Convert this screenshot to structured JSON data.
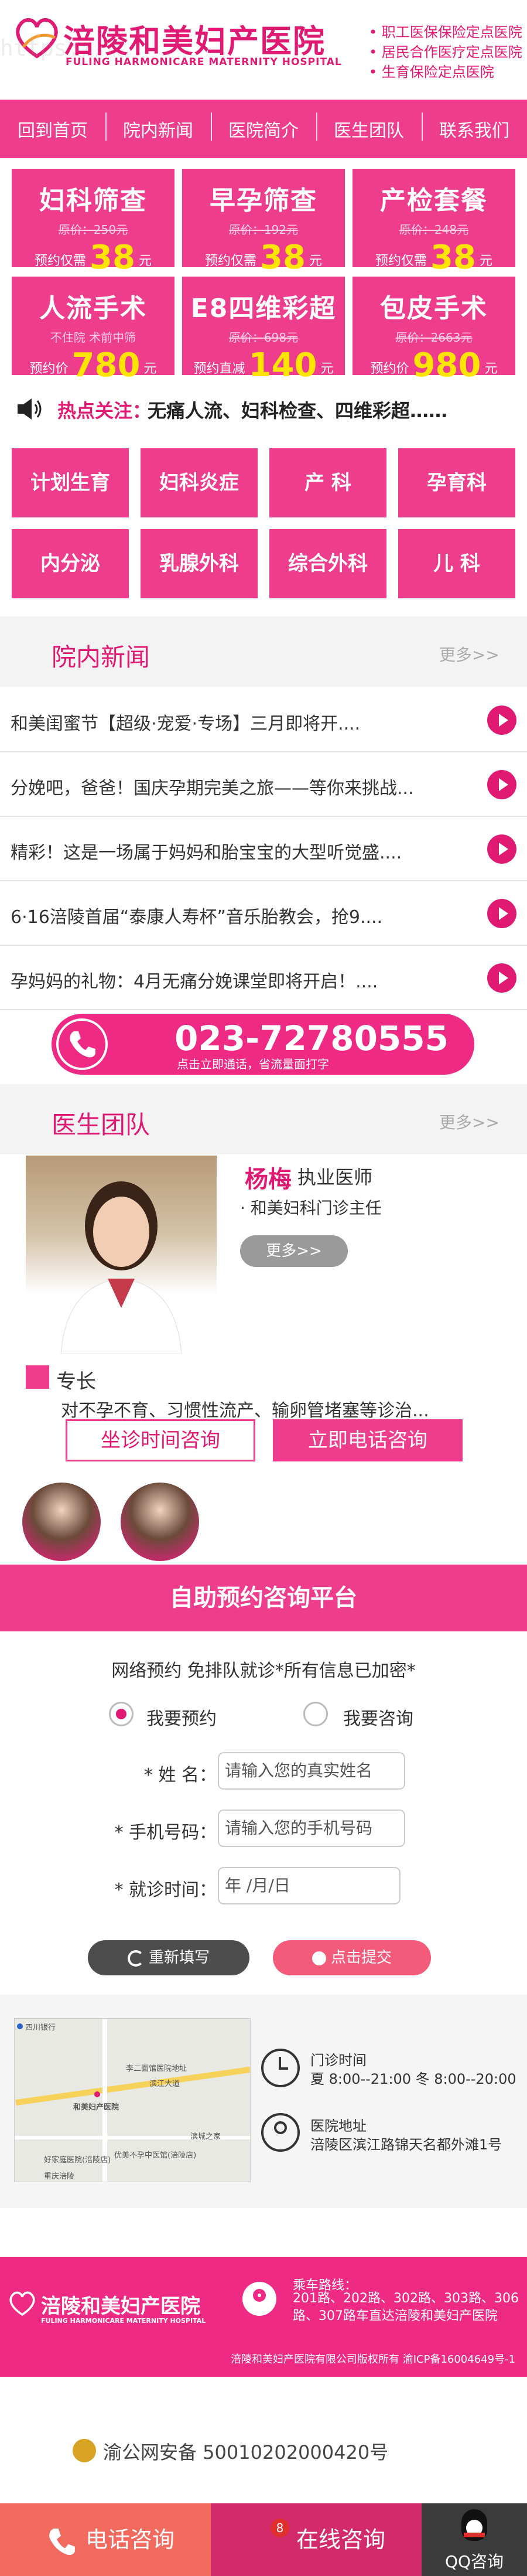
{
  "header": {
    "url_watermark": "https://m.",
    "logo_cn": "涪陵和美妇产医院",
    "logo_en": "FULING HARMONICARE MATERNITY HOSPITAL",
    "insurance": [
      "职工医保保险定点医院",
      "居民合作医疗定点医院",
      "生育保险定点医院"
    ]
  },
  "nav": [
    "回到首页",
    "院内新闻",
    "医院简介",
    "医生团队",
    "联系我们"
  ],
  "packages": [
    {
      "title": "妇科筛查",
      "orig": "原价：250元",
      "prefix": "预约仅需",
      "price": "38",
      "unit": "元"
    },
    {
      "title": "早孕筛查",
      "orig": "原价：192元",
      "prefix": "预约仅需",
      "price": "38",
      "unit": "元"
    },
    {
      "title": "产检套餐",
      "orig": "原价：248元",
      "prefix": "预约仅需",
      "price": "38",
      "unit": "元"
    },
    {
      "title": "人流手术",
      "orig": "不住院  术前中筛",
      "prefix": "预约价",
      "price": "780",
      "unit": "元"
    },
    {
      "title": "E8四维彩超",
      "orig": "原价：698元",
      "prefix": "预约直减",
      "price": "140",
      "unit": "元"
    },
    {
      "title": "包皮手术",
      "orig": "原价：2663元",
      "prefix": "预约价",
      "price": "980",
      "unit": "元"
    }
  ],
  "hot": {
    "label": "热点关注：",
    "text": "无痛人流、妇科检查、四维彩超……"
  },
  "categories": [
    "计划生育",
    "妇科炎症",
    "产  科",
    "孕育科",
    "内分泌",
    "乳腺外科",
    "综合外科",
    "儿  科"
  ],
  "news_section": {
    "title": "院内新闻",
    "more": "更多>>"
  },
  "news": [
    "和美闺蜜节【超级·宠爱·专场】三月即将开....",
    "分娩吧，爸爸！国庆孕期完美之旅——等你来挑战...",
    "精彩！这是一场属于妈妈和胎宝宝的大型听觉盛....",
    "6·16涪陵首届“泰康人寿杯”音乐胎教会，抢9....",
    "孕妈妈的礼物：4月无痛分娩课堂即将开启！...."
  ],
  "phone": {
    "number": "023-72780555",
    "sub": "点击立即通话，省流量面打字"
  },
  "doctor_section": {
    "title": "医生团队",
    "more": "更多>>"
  },
  "doctor": {
    "name": "杨梅",
    "title": "执业医师",
    "position": "· 和美妇科门诊主任",
    "more": "更多>>",
    "spec_label": "专长",
    "spec_text": "对不孕不育、习惯性流产、输卵管堵塞等诊治...",
    "btn_time": "坐诊时间咨询",
    "btn_call": "立即电话咨询"
  },
  "appointment": {
    "title": "自助预约咨询平台",
    "note": "网络预约 免排队就诊*所有信息已加密*",
    "radio1": "我要预约",
    "radio2": "我要咨询",
    "name_label": "* 姓    名：",
    "name_ph": "请输入您的真实姓名",
    "phone_label": "* 手机号码：",
    "phone_ph": "请输入您的手机号码",
    "time_label": "* 就诊时间：",
    "time_ph": "年  /月/日",
    "reset": "重新填写",
    "submit": "点击提交"
  },
  "map": {
    "labels": [
      "四川银行",
      "李二面馆医院地址",
      "滨江大道",
      "和美妇产医院",
      "好家庭医院(涪陵店)",
      "优美不孕中医馆(涪陵店)",
      "滨城之家",
      "重庆涪陵"
    ]
  },
  "info": {
    "hours_title": "门诊时间",
    "hours_value": "夏 8:00--21:00  冬 8:00--20:00",
    "addr_title": "医院地址",
    "addr_value": "涪陵区滨江路锦天名都外滩1号"
  },
  "footer": {
    "logo_cn": "涪陵和美妇产医院",
    "logo_en": "FULING HARMONICARE MATERNITY HOSPITAL",
    "bus_title": "乘车路线：",
    "bus_value": "201路、202路、302路、303路、306路、307路车直达涪陵和美妇产医院",
    "copyright": "涪陵和美妇产医院有限公司版权所有 渝ICP备16004649号-1"
  },
  "police": {
    "text": "渝公网安备 50010202000420号"
  },
  "bottom": {
    "phone": "电话咨询",
    "online": "在线咨询",
    "badge": "8",
    "qq": "QQ咨询"
  },
  "colors": {
    "brand_pink": "#ee3d8c",
    "accent_yellow": "#ffe400"
  }
}
